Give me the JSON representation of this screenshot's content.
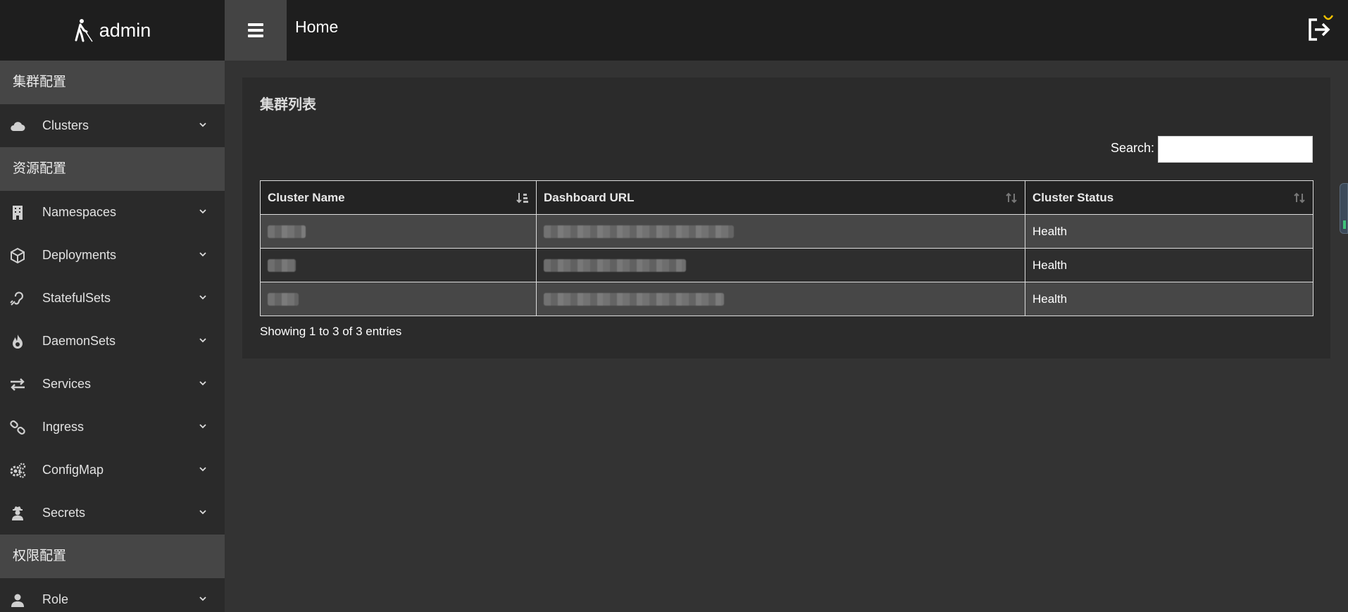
{
  "header": {
    "brand": "admin",
    "title": "Home"
  },
  "sidebar": {
    "sections": [
      {
        "title": "集群配置",
        "items": [
          {
            "label": "Clusters",
            "icon": "cloud-icon"
          }
        ]
      },
      {
        "title": "资源配置",
        "items": [
          {
            "label": "Namespaces",
            "icon": "building-icon"
          },
          {
            "label": "Deployments",
            "icon": "cube-icon"
          },
          {
            "label": "StatefulSets",
            "icon": "assistive-listening-icon"
          },
          {
            "label": "DaemonSets",
            "icon": "fire-icon"
          },
          {
            "label": "Services",
            "icon": "exchange-arrows-icon"
          },
          {
            "label": "Ingress",
            "icon": "link-icon"
          },
          {
            "label": "ConfigMap",
            "icon": "gears-icon"
          },
          {
            "label": "Secrets",
            "icon": "user-secret-icon"
          }
        ]
      },
      {
        "title": "权限配置",
        "items": [
          {
            "label": "Role",
            "icon": "user-icon"
          }
        ]
      }
    ]
  },
  "panel": {
    "title": "集群列表",
    "search_label": "Search:",
    "search_value": "",
    "columns": [
      "Cluster Name",
      "Dashboard URL",
      "Cluster Status"
    ],
    "rows": [
      {
        "status": "Health"
      },
      {
        "status": "Health"
      },
      {
        "status": "Health"
      }
    ],
    "info": "Showing 1 to 3 of 3 entries"
  }
}
